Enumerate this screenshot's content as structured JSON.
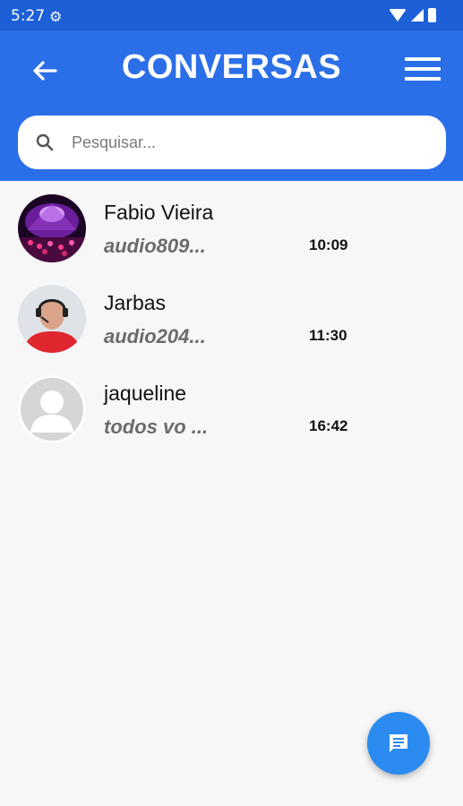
{
  "status_bar": {
    "time": "5:27",
    "settings_icon": "gear-icon",
    "icons": [
      "wifi-icon",
      "signal-icon",
      "battery-icon"
    ]
  },
  "app_bar": {
    "back_icon": "arrow-back-icon",
    "title": "CONVERSAS",
    "menu_icon": "hamburger-menu-icon"
  },
  "search": {
    "placeholder": "Pesquisar...",
    "icon": "search-icon"
  },
  "conversations": [
    {
      "name": "Fabio Vieira",
      "preview": "audio809...",
      "time": "10:09",
      "avatar": "concert-photo"
    },
    {
      "name": "Jarbas",
      "preview": "audio204...",
      "time": "11:30",
      "avatar": "person-with-headset-photo"
    },
    {
      "name": "jaqueline",
      "preview": "todos vo ...",
      "time": "16:42",
      "avatar": "default-user-silhouette"
    }
  ],
  "fab": {
    "icon": "chat-message-icon"
  },
  "colors": {
    "status_bar": "#1c5fd6",
    "app_bar": "#2b6fe8",
    "fab": "#2b8bf0",
    "background": "#f7f7f8"
  }
}
